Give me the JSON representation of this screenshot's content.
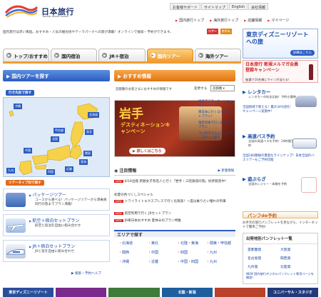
{
  "header": {
    "logo_text": "日本旅行",
    "logo_sub": "NIPPON TRAVEL AGENCY",
    "topnav": [
      "お客様サポート",
      "サイトマップ",
      "English",
      "会社情報"
    ],
    "subnav": [
      "国内旅行トップ",
      "海外旅行トップ",
      "店舗情報",
      "マイページ"
    ],
    "intro": "国内旅行は赤い風船。おすすめ・人気の観光地やテーマパークへの旅が満載！オンラインで検索・予約ができます。",
    "badges": [
      "ツアー",
      "ホテル"
    ]
  },
  "tabs": [
    {
      "label": "トップ/おすすめ",
      "active": false
    },
    {
      "label": "国内宿泊",
      "active": false
    },
    {
      "label": "JR＋宿泊",
      "active": false
    },
    {
      "label": "国内ツアー",
      "active": true
    },
    {
      "label": "海外ツアー",
      "active": false
    }
  ],
  "left": {
    "search_title": "国内ツアーを探す",
    "by_area": "行き先別で探す",
    "regions": [
      "北海道",
      "東北",
      "関東",
      "甲信越",
      "北陸",
      "東海",
      "近畿",
      "中国",
      "四国",
      "九州",
      "沖縄"
    ],
    "by_type": "ツアータイプ別で探す",
    "tours": [
      {
        "title": "パッケージツアー",
        "desc": "コースから選べる！パッケージツアーから添乗員同行の旅までプラン満載！"
      },
      {
        "title": "航空＋宿泊セットプラン",
        "desc": "航空と宿泊を自由に組み合わせ"
      },
      {
        "title": "JR＋宿泊セットプラン",
        "desc": "JRと宿を自由に組み合わせ"
      }
    ],
    "help_link": "検索・予約ヘルプ"
  },
  "middle": {
    "title": "おすすめ情報",
    "region_text": "首都圏のお客さまにおすすめの情報です",
    "change_label": "変更する",
    "region_select": "首都圏",
    "banner_title_1": "岩手",
    "banner_title_2": "デスティネーションキャンペーン",
    "banner_button": "詳しくはこちら",
    "side_items": [
      "岩手デスティネーションキャンペーン",
      "東日本に行くならJRセットプラン！",
      "限定列車で行くJRセットプラン",
      "下川淳子さんと行くパワースポット巡り"
    ],
    "notice_title": "注目情報",
    "notice_link": "新着情報",
    "news": [
      {
        "tag": "NEW",
        "text": "6/16出発 新鋭女子有名人と行く「岩手・三陸鉄道の旅」好評発売中！"
      },
      {
        "tag": "",
        "text": "初夏の色づくしスペシャル"
      },
      {
        "tag": "NEW",
        "text": "トワイライトエクスプレスで行く北海道！一度は乗りたい憧れの列車"
      },
      {
        "tag": "NEW",
        "text": "航空利用で行く JRセットプラン"
      },
      {
        "tag": "NEW",
        "text": "JR東日本おすすめ 夏休みのプラン特集"
      }
    ],
    "area_title": "エリアで探す",
    "areas": [
      "北海道",
      "東北",
      "北陸・東海",
      "関東・甲信越",
      "関西",
      "中国",
      "四国",
      "九州",
      "沖縄",
      "近畿",
      "中国・四国",
      "九州"
    ]
  },
  "right": {
    "disney_title": "東京ディズニーリゾート への旅",
    "disney_button": "詳細はこちら",
    "member_campaign": "日本旅行 新規メルマガ会員登録キャンペーン",
    "member_prize": "抽選で10名様にワインが当たる！",
    "services": [
      {
        "title": "レンタカー",
        "desc": "レンタカーの料金比較！予約も簡単"
      },
      {
        "title": "高速バス予約",
        "desc": "全国の高速バスを予約！24時間予約"
      },
      {
        "title": "遊ぶらざ",
        "desc": "全国のレジャー・体験を予約"
      }
    ],
    "rental_note": "全国地域で使える！最大34％割引キャンペーン実施中！",
    "bus_note": "全国180路線の豊富なラインナップ！日本全国のバスツアーもご予約可能",
    "pamphlet_title": "パンフde予約",
    "pamphlet_desc": "お手元の旅行パンフレットを見ながら、インターネットで簡単ご予約！",
    "pamphlet_list_title": "出発地別パンフレット一覧",
    "departures": [
      "首都圏発",
      "大阪発",
      "名古屋発",
      "関西発",
      "九州発",
      "北陸発"
    ],
    "new_notice": "NEW 国内旅行デジタルパンフレット専用ページを開設！"
  },
  "bottom_strip": [
    "東京ディズニーリゾート",
    "",
    "",
    "北陸・新潟",
    "",
    "ユニバーサル・スタジオ"
  ],
  "colors": {
    "accent_orange": "#f19c32",
    "brand_blue": "#2b5cc1",
    "red": "#d22"
  }
}
